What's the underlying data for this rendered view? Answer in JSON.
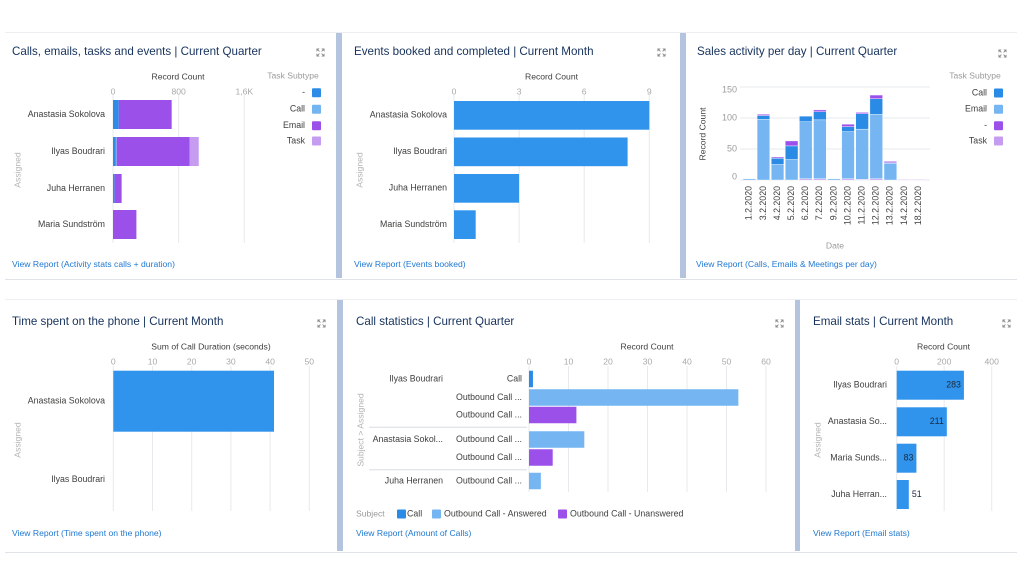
{
  "dashboard": {
    "panels": [
      {
        "link_text": "View Report (Activity stats calls + duration)",
        "expand_icon": "expand-icon"
      },
      {
        "link_text": "View Report (Events booked)",
        "expand_icon": "expand-icon"
      },
      {
        "link_text": "View Report (Calls, Emails & Meetings per day)",
        "expand_icon": "expand-icon"
      },
      {
        "link_text": "View Report (Time spent on the phone)",
        "expand_icon": "expand-icon"
      },
      {
        "link_text": "View Report (Amount of Calls)",
        "expand_icon": "expand-icon"
      },
      {
        "link_text": "View Report (Email stats)",
        "expand_icon": "expand-icon"
      }
    ],
    "colors": {
      "title": "#16325c",
      "link": "#1f78d1",
      "divider": "#b4c4df",
      "bar": "#3093ec"
    }
  },
  "chart_data": [
    {
      "type": "bar",
      "orientation": "horizontal",
      "stacked": true,
      "title": "Calls, emails, tasks and events | Current Quarter",
      "xlabel": "Record Count",
      "ylabel": "Assigned",
      "categories": [
        "Anastasia Sokolova",
        "Ilyas Boudrari",
        "Juha Herranen",
        "Maria Sundström"
      ],
      "series": [
        {
          "name": "-",
          "color": "#2d8ce6",
          "values": [
            70,
            35,
            20,
            0
          ]
        },
        {
          "name": "Call",
          "color": "#72b5f1",
          "values": [
            0,
            10,
            0,
            0
          ]
        },
        {
          "name": "Email",
          "color": "#9b50ea",
          "values": [
            645,
            890,
            85,
            285
          ]
        },
        {
          "name": "Task",
          "color": "#c69cf1",
          "values": [
            0,
            110,
            0,
            0
          ]
        }
      ],
      "xlim": [
        0,
        1600
      ],
      "xticks": [
        0,
        800,
        1600
      ],
      "xtick_labels": [
        "0",
        "800",
        "1,6K"
      ],
      "grid": true,
      "legend": {
        "title": "Task Subtype",
        "position": "right",
        "items": [
          "-",
          "Call",
          "Email",
          "Task"
        ]
      }
    },
    {
      "type": "bar",
      "orientation": "horizontal",
      "title": "Events booked and completed | Current Month",
      "xlabel": "Record Count",
      "ylabel": "Assigned",
      "categories": [
        "Anastasia Sokolova",
        "Ilyas Boudrari",
        "Juha Herranen",
        "Maria Sundström"
      ],
      "values": [
        9,
        8,
        3,
        1
      ],
      "color": "#3093ec",
      "xlim": [
        0,
        9
      ],
      "xticks": [
        0,
        3,
        6,
        9
      ],
      "grid": true
    },
    {
      "type": "bar",
      "orientation": "vertical",
      "stacked": true,
      "title": "Sales activity per day | Current Quarter",
      "xlabel": "Date",
      "ylabel": "Record Count",
      "categories": [
        "1.2.2020",
        "3.2.2020",
        "4.2.2020",
        "5.2.2020",
        "6.2.2020",
        "7.2.2020",
        "9.2.2020",
        "10.2.2020",
        "11.2.2020",
        "12.2.2020",
        "13.2.2020",
        "14.2.2020",
        "18.2.2020"
      ],
      "series": [
        {
          "name": "Task",
          "color": "#c69cf1",
          "values": [
            0,
            0,
            0,
            0,
            2,
            2,
            0,
            2,
            1,
            2,
            0,
            1,
            1
          ]
        },
        {
          "name": "Email",
          "color": "#74b5f2",
          "values": [
            2,
            98,
            25,
            33,
            92,
            95,
            2,
            76,
            81,
            104,
            27,
            0,
            0
          ]
        },
        {
          "name": "Call",
          "color": "#2a8be6",
          "values": [
            0,
            6,
            10,
            22,
            9,
            13,
            0,
            8,
            25,
            25,
            1,
            0,
            0
          ]
        },
        {
          "name": "-",
          "color": "#9b50ea",
          "values": [
            0,
            2,
            2,
            8,
            0,
            3,
            0,
            4,
            2,
            6,
            2,
            0,
            0
          ]
        }
      ],
      "ylim": [
        0,
        150
      ],
      "yticks": [
        0,
        50,
        100,
        150
      ],
      "grid": true,
      "legend": {
        "title": "Task Subtype",
        "position": "right",
        "items": [
          "Call",
          "Email",
          "-",
          "Task"
        ]
      }
    },
    {
      "type": "bar",
      "orientation": "horizontal",
      "title": "Time spent on the phone | Current Month",
      "xlabel": "Sum of Call Duration (seconds)",
      "ylabel": "Assigned",
      "categories": [
        "Anastasia Sokolova",
        "Ilyas Boudrari"
      ],
      "values": [
        41,
        0
      ],
      "color": "#3093ec",
      "xlim": [
        0,
        50
      ],
      "xticks": [
        0,
        10,
        20,
        30,
        40,
        50
      ],
      "grid": true
    },
    {
      "type": "bar",
      "orientation": "horizontal",
      "title": "Call statistics | Current Quarter",
      "xlabel": "Record Count",
      "ylabel": "Subject > Assigned",
      "xlim": [
        0,
        60
      ],
      "xticks": [
        0,
        10,
        20,
        30,
        40,
        50,
        60
      ],
      "grid": true,
      "groups": [
        {
          "label": "Ilyas Boudrari",
          "rows": [
            {
              "label": "Call",
              "series": "Call",
              "value": 1
            },
            {
              "label": "Outbound Call ...",
              "series": "Outbound Call - Answered",
              "value": 53
            },
            {
              "label": "Outbound Call ...",
              "series": "Outbound Call - Unanswered",
              "value": 12
            }
          ]
        },
        {
          "label": "Anastasia Sokol...",
          "rows": [
            {
              "label": "Outbound Call ...",
              "series": "Outbound Call - Answered",
              "value": 14
            },
            {
              "label": "Outbound Call ...",
              "series": "Outbound Call - Unanswered",
              "value": 6
            }
          ]
        },
        {
          "label": "Juha Herranen",
          "rows": [
            {
              "label": "Outbound Call ...",
              "series": "Outbound Call - Answered",
              "value": 3
            }
          ]
        }
      ],
      "legend": {
        "title": "Subject",
        "position": "bottom",
        "items": [
          {
            "name": "Call",
            "color": "#2a8be6"
          },
          {
            "name": "Outbound Call - Answered",
            "color": "#74b5f2"
          },
          {
            "name": "Outbound Call - Unanswered",
            "color": "#9b50ea"
          }
        ]
      }
    },
    {
      "type": "bar",
      "orientation": "horizontal",
      "title": "Email stats | Current Month",
      "xlabel": "Record Count",
      "ylabel": "Assigned",
      "categories": [
        "Ilyas Boudrari",
        "Anastasia So...",
        "Maria Sunds...",
        "Juha Herran..."
      ],
      "values": [
        283,
        211,
        83,
        51
      ],
      "data_labels": [
        "283",
        "211",
        "83",
        "51"
      ],
      "color": "#3093ec",
      "xlim": [
        0,
        400
      ],
      "xticks": [
        0,
        200,
        400
      ],
      "grid": true
    }
  ]
}
